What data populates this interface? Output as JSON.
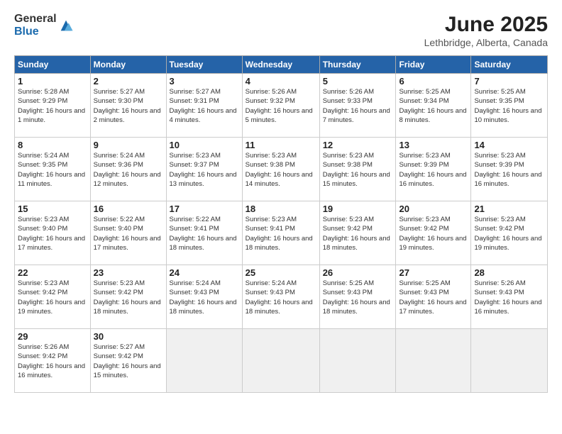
{
  "logo": {
    "general": "General",
    "blue": "Blue"
  },
  "title": "June 2025",
  "subtitle": "Lethbridge, Alberta, Canada",
  "days_of_week": [
    "Sunday",
    "Monday",
    "Tuesday",
    "Wednesday",
    "Thursday",
    "Friday",
    "Saturday"
  ],
  "weeks": [
    [
      {
        "num": "1",
        "sunrise": "5:28 AM",
        "sunset": "9:29 PM",
        "daylight": "16 hours and 1 minute."
      },
      {
        "num": "2",
        "sunrise": "5:27 AM",
        "sunset": "9:30 PM",
        "daylight": "16 hours and 2 minutes."
      },
      {
        "num": "3",
        "sunrise": "5:27 AM",
        "sunset": "9:31 PM",
        "daylight": "16 hours and 4 minutes."
      },
      {
        "num": "4",
        "sunrise": "5:26 AM",
        "sunset": "9:32 PM",
        "daylight": "16 hours and 5 minutes."
      },
      {
        "num": "5",
        "sunrise": "5:26 AM",
        "sunset": "9:33 PM",
        "daylight": "16 hours and 7 minutes."
      },
      {
        "num": "6",
        "sunrise": "5:25 AM",
        "sunset": "9:34 PM",
        "daylight": "16 hours and 8 minutes."
      },
      {
        "num": "7",
        "sunrise": "5:25 AM",
        "sunset": "9:35 PM",
        "daylight": "16 hours and 10 minutes."
      }
    ],
    [
      {
        "num": "8",
        "sunrise": "5:24 AM",
        "sunset": "9:35 PM",
        "daylight": "16 hours and 11 minutes."
      },
      {
        "num": "9",
        "sunrise": "5:24 AM",
        "sunset": "9:36 PM",
        "daylight": "16 hours and 12 minutes."
      },
      {
        "num": "10",
        "sunrise": "5:23 AM",
        "sunset": "9:37 PM",
        "daylight": "16 hours and 13 minutes."
      },
      {
        "num": "11",
        "sunrise": "5:23 AM",
        "sunset": "9:38 PM",
        "daylight": "16 hours and 14 minutes."
      },
      {
        "num": "12",
        "sunrise": "5:23 AM",
        "sunset": "9:38 PM",
        "daylight": "16 hours and 15 minutes."
      },
      {
        "num": "13",
        "sunrise": "5:23 AM",
        "sunset": "9:39 PM",
        "daylight": "16 hours and 16 minutes."
      },
      {
        "num": "14",
        "sunrise": "5:23 AM",
        "sunset": "9:39 PM",
        "daylight": "16 hours and 16 minutes."
      }
    ],
    [
      {
        "num": "15",
        "sunrise": "5:23 AM",
        "sunset": "9:40 PM",
        "daylight": "16 hours and 17 minutes."
      },
      {
        "num": "16",
        "sunrise": "5:22 AM",
        "sunset": "9:40 PM",
        "daylight": "16 hours and 17 minutes."
      },
      {
        "num": "17",
        "sunrise": "5:22 AM",
        "sunset": "9:41 PM",
        "daylight": "16 hours and 18 minutes."
      },
      {
        "num": "18",
        "sunrise": "5:23 AM",
        "sunset": "9:41 PM",
        "daylight": "16 hours and 18 minutes."
      },
      {
        "num": "19",
        "sunrise": "5:23 AM",
        "sunset": "9:42 PM",
        "daylight": "16 hours and 18 minutes."
      },
      {
        "num": "20",
        "sunrise": "5:23 AM",
        "sunset": "9:42 PM",
        "daylight": "16 hours and 19 minutes."
      },
      {
        "num": "21",
        "sunrise": "5:23 AM",
        "sunset": "9:42 PM",
        "daylight": "16 hours and 19 minutes."
      }
    ],
    [
      {
        "num": "22",
        "sunrise": "5:23 AM",
        "sunset": "9:42 PM",
        "daylight": "16 hours and 19 minutes."
      },
      {
        "num": "23",
        "sunrise": "5:23 AM",
        "sunset": "9:42 PM",
        "daylight": "16 hours and 18 minutes."
      },
      {
        "num": "24",
        "sunrise": "5:24 AM",
        "sunset": "9:43 PM",
        "daylight": "16 hours and 18 minutes."
      },
      {
        "num": "25",
        "sunrise": "5:24 AM",
        "sunset": "9:43 PM",
        "daylight": "16 hours and 18 minutes."
      },
      {
        "num": "26",
        "sunrise": "5:25 AM",
        "sunset": "9:43 PM",
        "daylight": "16 hours and 18 minutes."
      },
      {
        "num": "27",
        "sunrise": "5:25 AM",
        "sunset": "9:43 PM",
        "daylight": "16 hours and 17 minutes."
      },
      {
        "num": "28",
        "sunrise": "5:26 AM",
        "sunset": "9:43 PM",
        "daylight": "16 hours and 16 minutes."
      }
    ],
    [
      {
        "num": "29",
        "sunrise": "5:26 AM",
        "sunset": "9:42 PM",
        "daylight": "16 hours and 16 minutes."
      },
      {
        "num": "30",
        "sunrise": "5:27 AM",
        "sunset": "9:42 PM",
        "daylight": "16 hours and 15 minutes."
      },
      null,
      null,
      null,
      null,
      null
    ]
  ]
}
